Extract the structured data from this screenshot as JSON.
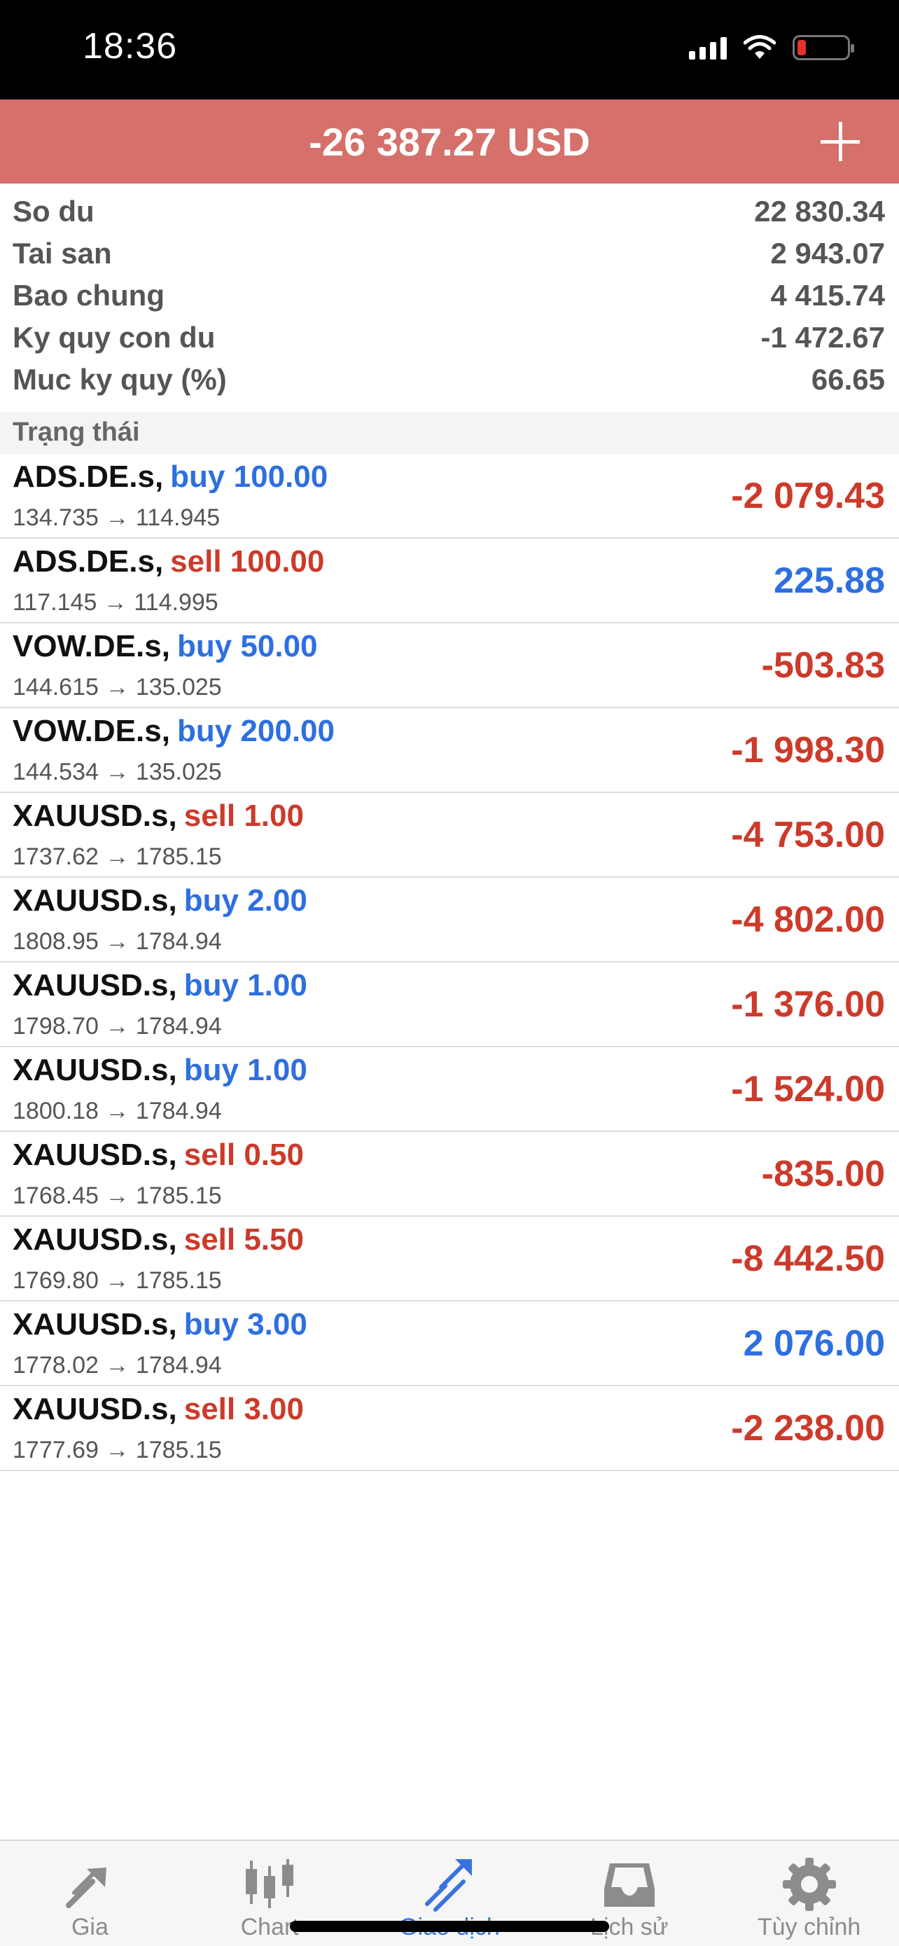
{
  "status_bar": {
    "time": "18:36"
  },
  "header": {
    "title": "-26 387.27 USD"
  },
  "summary": [
    {
      "label": "So du",
      "value": "22 830.34"
    },
    {
      "label": "Tai san",
      "value": "2 943.07"
    },
    {
      "label": "Bao chung",
      "value": "4 415.74"
    },
    {
      "label": "Ky quy con du",
      "value": "-1 472.67"
    },
    {
      "label": "Muc ky quy (%)",
      "value": "66.65"
    }
  ],
  "section": {
    "title": "Trạng thái"
  },
  "positions": [
    {
      "symbol": "ADS.DE.s,",
      "side": "buy",
      "volume": "buy 100.00",
      "open": "134.735",
      "current": "114.945",
      "profit": "-2 079.43"
    },
    {
      "symbol": "ADS.DE.s,",
      "side": "sell",
      "volume": "sell 100.00",
      "open": "117.145",
      "current": "114.995",
      "profit": "225.88"
    },
    {
      "symbol": "VOW.DE.s,",
      "side": "buy",
      "volume": "buy 50.00",
      "open": "144.615",
      "current": "135.025",
      "profit": "-503.83"
    },
    {
      "symbol": "VOW.DE.s,",
      "side": "buy",
      "volume": "buy 200.00",
      "open": "144.534",
      "current": "135.025",
      "profit": "-1 998.30"
    },
    {
      "symbol": "XAUUSD.s,",
      "side": "sell",
      "volume": "sell 1.00",
      "open": "1737.62",
      "current": "1785.15",
      "profit": "-4 753.00"
    },
    {
      "symbol": "XAUUSD.s,",
      "side": "buy",
      "volume": "buy 2.00",
      "open": "1808.95",
      "current": "1784.94",
      "profit": "-4 802.00"
    },
    {
      "symbol": "XAUUSD.s,",
      "side": "buy",
      "volume": "buy 1.00",
      "open": "1798.70",
      "current": "1784.94",
      "profit": "-1 376.00"
    },
    {
      "symbol": "XAUUSD.s,",
      "side": "buy",
      "volume": "buy 1.00",
      "open": "1800.18",
      "current": "1784.94",
      "profit": "-1 524.00"
    },
    {
      "symbol": "XAUUSD.s,",
      "side": "sell",
      "volume": "sell 0.50",
      "open": "1768.45",
      "current": "1785.15",
      "profit": "-835.00"
    },
    {
      "symbol": "XAUUSD.s,",
      "side": "sell",
      "volume": "sell 5.50",
      "open": "1769.80",
      "current": "1785.15",
      "profit": "-8 442.50"
    },
    {
      "symbol": "XAUUSD.s,",
      "side": "buy",
      "volume": "buy 3.00",
      "open": "1778.02",
      "current": "1784.94",
      "profit": "2 076.00"
    },
    {
      "symbol": "XAUUSD.s,",
      "side": "sell",
      "volume": "sell 3.00",
      "open": "1777.69",
      "current": "1785.15",
      "profit": "-2 238.00"
    }
  ],
  "tabs": [
    {
      "label": "Gia",
      "icon": "quotes-arrows-icon"
    },
    {
      "label": "Chart",
      "icon": "candlestick-icon"
    },
    {
      "label": "Giao dịch",
      "icon": "trade-icon",
      "active": true
    },
    {
      "label": "Lịch sử",
      "icon": "history-inbox-icon"
    },
    {
      "label": "Tùy chỉnh",
      "icon": "gear-icon"
    }
  ],
  "colors": {
    "header": "#d5706a",
    "buy": "#2e6fe0",
    "sell": "#cc3a2a",
    "active_tab": "#3a73e0"
  }
}
